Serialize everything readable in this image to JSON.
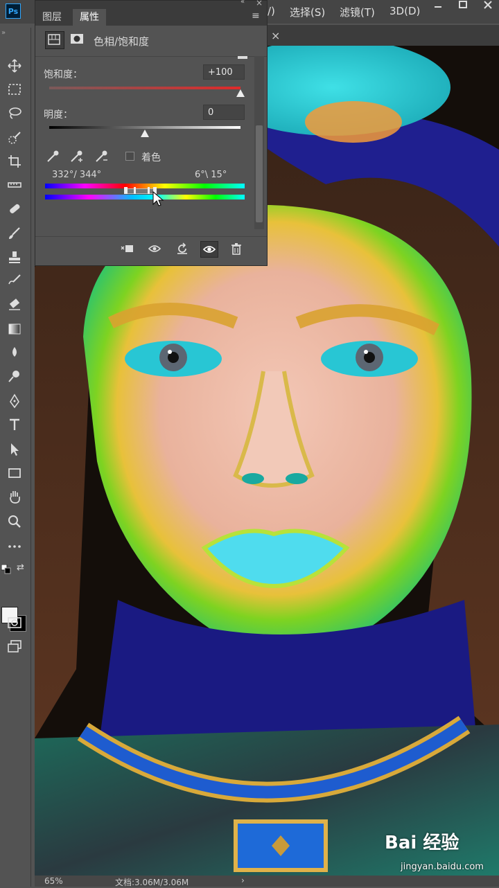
{
  "menubar": {
    "logo": "Ps",
    "items": [
      "/)",
      "选择(S)",
      "滤镜(T)",
      "3D(D)"
    ]
  },
  "document": {
    "close_glyph": "×"
  },
  "panel": {
    "tabs": [
      "图层",
      "属性"
    ],
    "active_tab": "属性",
    "title": "色相/饱和度",
    "saturation_label": "饱和度：",
    "saturation_value": "+100",
    "saturation_level": 1.0,
    "lightness_label": "明度：",
    "lightness_value": "0",
    "lightness_level": 0.5,
    "colorize_label": "着色",
    "colorize_checked": false,
    "range_left": "332°/ 344°",
    "range_right": "6°\\ 15°"
  },
  "status": {
    "zoom": "65%",
    "doc_info": "文档:3.06M/3.06M",
    "arrow": "›"
  },
  "watermark": {
    "brand": "Bai 经验",
    "url": "jingyan.baidu.com"
  },
  "colors": {
    "accent_blue": "#31a8ff",
    "saturation_red": "#e02a2a",
    "panel_bg": "#535353"
  }
}
